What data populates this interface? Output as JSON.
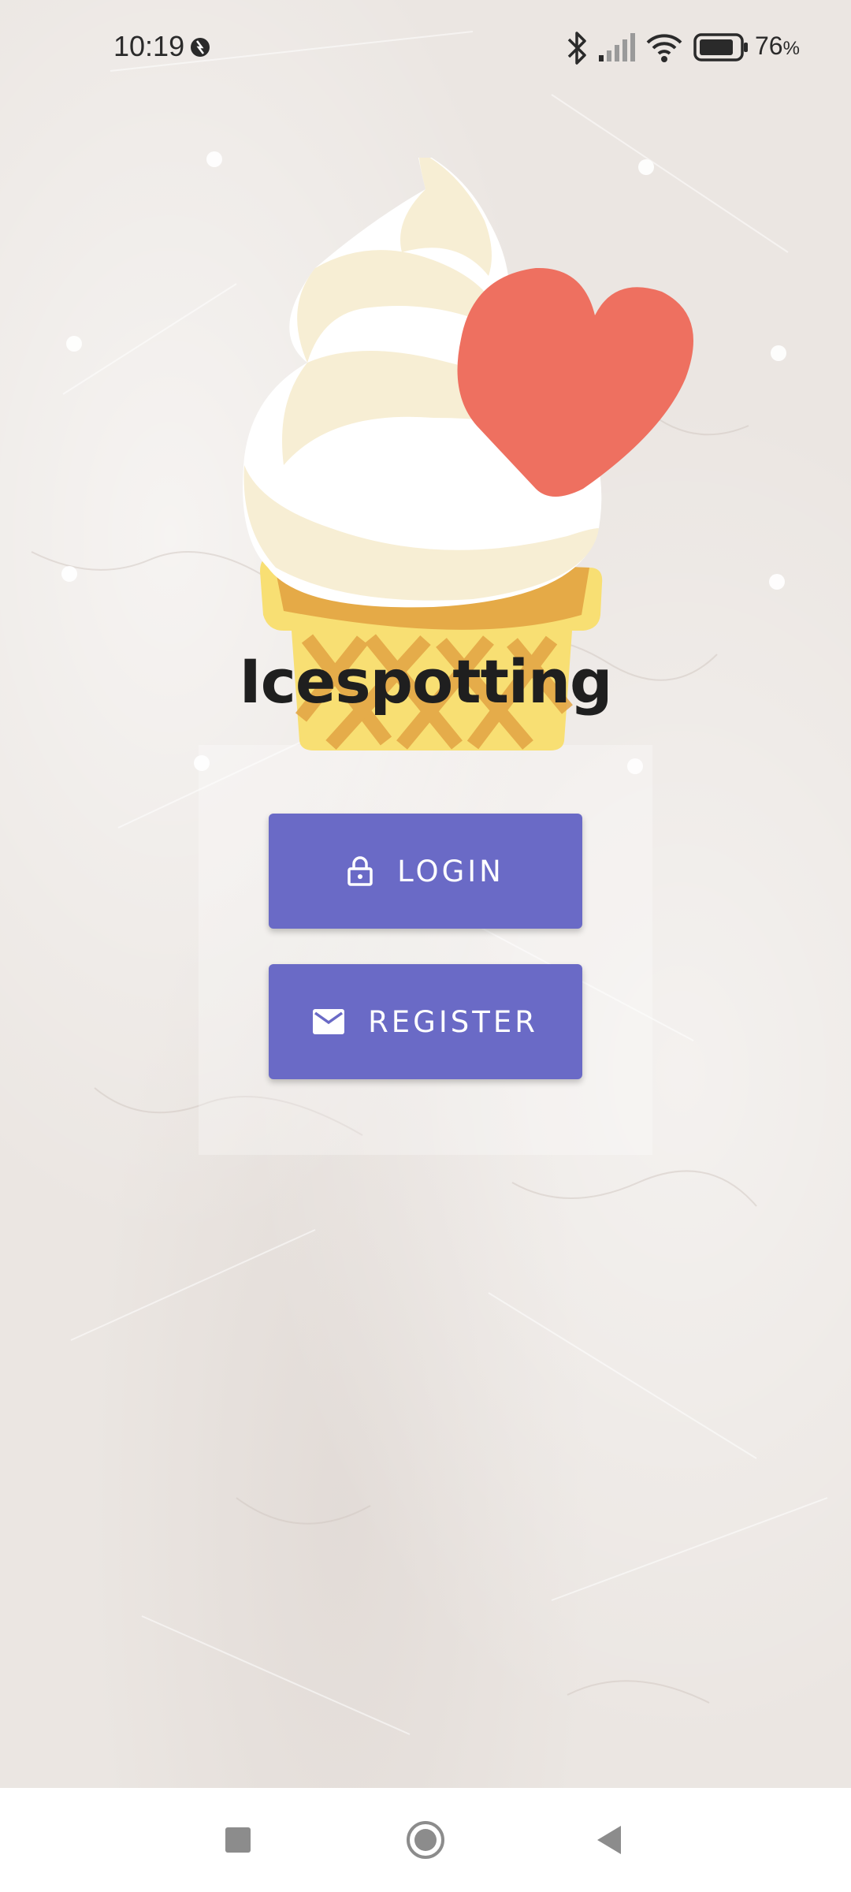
{
  "status_bar": {
    "time": "10:19",
    "battery_percent": "76",
    "battery_unit": "%",
    "icons": [
      "notification-app-icon",
      "bluetooth-icon",
      "signal-icon",
      "wifi-icon",
      "battery-icon"
    ]
  },
  "app": {
    "title": "Icespotting",
    "logo": "ice-cream-heart-logo"
  },
  "buttons": {
    "login_label": "LOGIN",
    "login_icon": "lock-icon",
    "register_label": "REGISTER",
    "register_icon": "mail-icon"
  },
  "nav_bar": {
    "icons": [
      "recents-square-icon",
      "home-circle-icon",
      "back-triangle-icon"
    ]
  },
  "colors": {
    "button": "#6a6ac6",
    "heart": "#ee7060",
    "cone": "#f8df73",
    "cone_shade": "#e2a443",
    "cream_light": "#f7eed4"
  }
}
